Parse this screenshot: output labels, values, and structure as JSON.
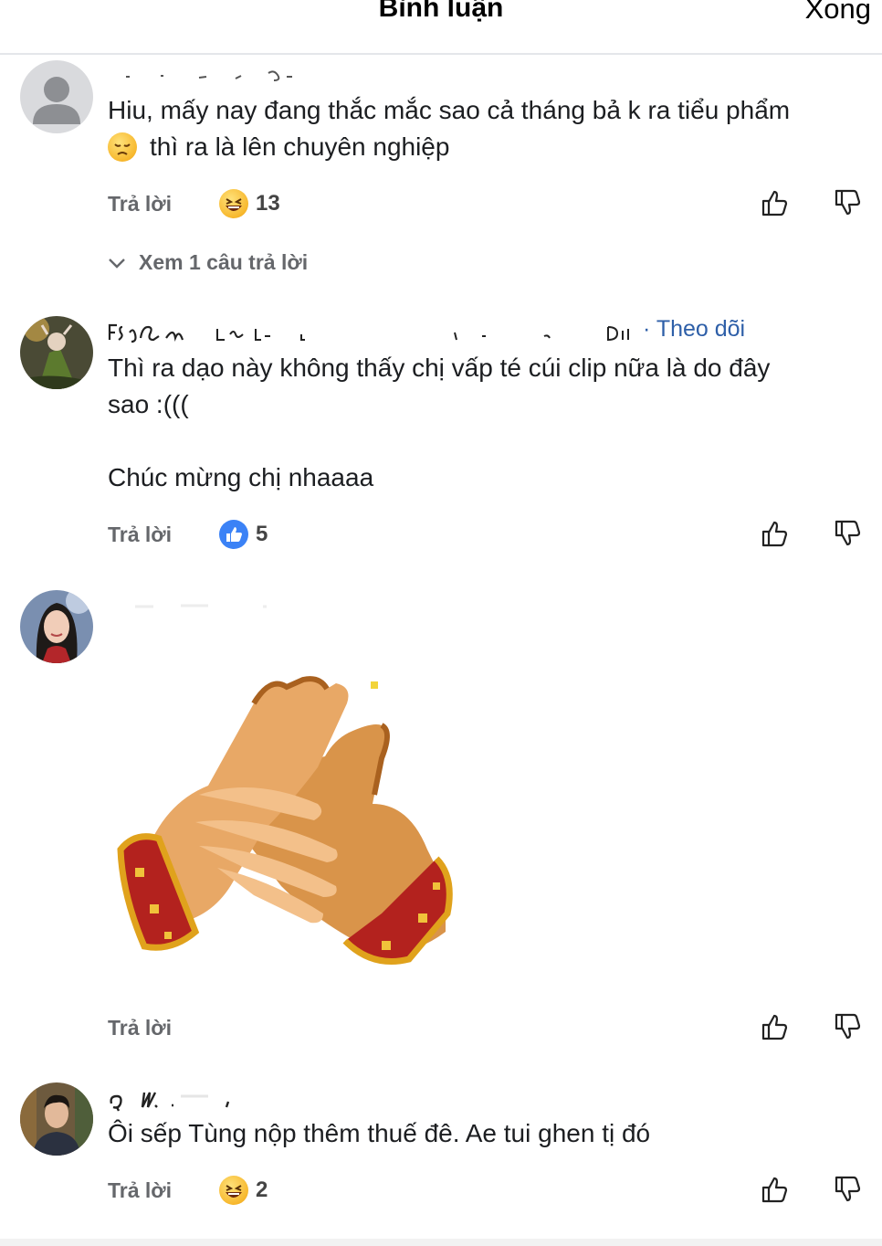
{
  "header": {
    "title": "Bình luận",
    "done_label": "Xong"
  },
  "comments": [
    {
      "text_lines": [
        "Hiu, mấy nay đang thắc mắc sao cả tháng bả k ra tiểu phẩm",
        "thì ra là lên chuyên nghiệp"
      ],
      "reply_label": "Trả lời",
      "reaction_icon": "haha-emoji",
      "reaction_count": "13",
      "view_replies_label": "Xem 1 câu trả lời"
    },
    {
      "follow_label": "· Theo dõi",
      "text_lines": [
        "Thì ra dạo này không thấy chị vấp té cúi clip nữa là do đây",
        "sao :(((",
        "",
        "Chúc mừng chị nhaaaa"
      ],
      "reply_label": "Trả lời",
      "reaction_icon": "like-icon",
      "reaction_count": "5"
    },
    {
      "sticker": "clapping-hands-sticker",
      "reply_label": "Trả lời"
    },
    {
      "text_lines": [
        "Ôi sếp Tùng nộp thêm thuế đê. Ae tui ghen tị đó"
      ],
      "reply_label": "Trả lời",
      "reaction_icon": "haha-emoji",
      "reaction_count": "2"
    }
  ],
  "colors": {
    "link": "#2e5fa8",
    "muted": "#65676b",
    "like_blue": "#3b82f6"
  }
}
